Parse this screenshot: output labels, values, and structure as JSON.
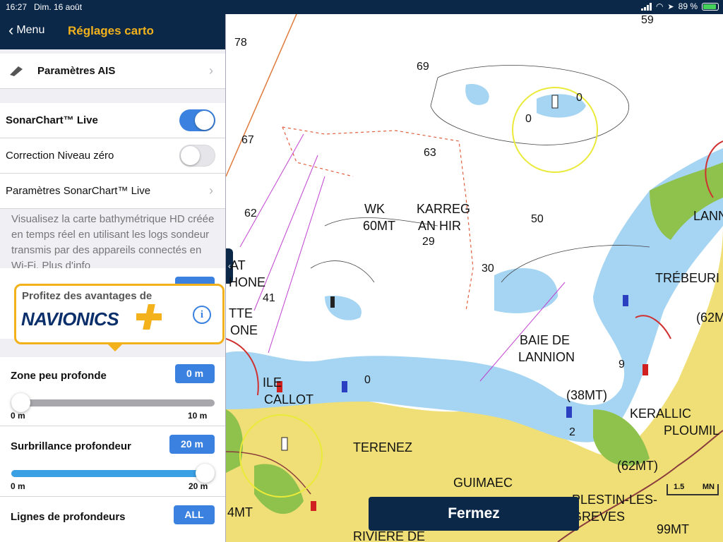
{
  "status": {
    "time": "16:27",
    "date": "Dim. 16 août",
    "battery": "89 %",
    "battery_level": 0.89
  },
  "nav": {
    "back_label": "Menu",
    "title": "Réglages carto"
  },
  "settings": {
    "ais_label": "Paramètres AIS",
    "sonarchart_label": "SonarChart™ Live",
    "sonarchart_on": true,
    "correction_label": "Correction Niveau zéro",
    "correction_on": false,
    "sonar_params_label": "Paramètres SonarChart™ Live",
    "description": "Visualisez la carte bathymétrique HD créée en temps réel en utilisant les logs sondeur transmis par des appareils connectés en Wi-Fi.",
    "more_info_link": "Plus d'info"
  },
  "promo": {
    "text": "Profitez des avantages de",
    "logo": "NAVIONICS"
  },
  "shallow": {
    "label": "Zone peu profonde",
    "value": "0 m",
    "min": "0 m",
    "max": "10 m",
    "level": 0.0
  },
  "highlight": {
    "label": "Surbrillance profondeur",
    "value": "20 m",
    "min": "0 m",
    "max": "20 m",
    "level": 1.0
  },
  "contours": {
    "label": "Lignes de profondeurs",
    "value": "ALL"
  },
  "map": {
    "labels": {
      "wk": "WK",
      "wk2": "60MT",
      "karreg": "KARREG",
      "anhir": "AN HIR",
      "baie": "BAIE DE",
      "lannion": "LANNION",
      "ile": "ILE",
      "callot": "CALLOT",
      "terenez": "TERENEZ",
      "guimaec": "GUIMAEC",
      "keral": "KERALLIC",
      "ploumil": "PLOUMIL",
      "plestin": "PLESTIN-LES-",
      "greves": "GREVES",
      "trebeur": "TRÉBEURI",
      "lann": "LANN",
      "riviere": "RIVIERE DE",
      "at": "AT",
      "hone": "HONE",
      "tte": "TTE",
      "one": "ONE",
      "mt38": "(38MT)",
      "mt62": "(62MT)",
      "mt62b": "(62M",
      "mt99": "99MT",
      "mt4": "4MT"
    },
    "depths": {
      "d78": "78",
      "d59": "59",
      "d69": "69",
      "d67": "67",
      "d63": "63",
      "d62": "62",
      "d50": "50",
      "d29": "29",
      "d30": "30",
      "d41": "41",
      "d0a": "0",
      "d0b": "0",
      "d0c": "0",
      "d9": "9",
      "d2": "2"
    },
    "close_button": "Fermez",
    "scale": {
      "value": "1.5",
      "unit": "MN"
    }
  }
}
